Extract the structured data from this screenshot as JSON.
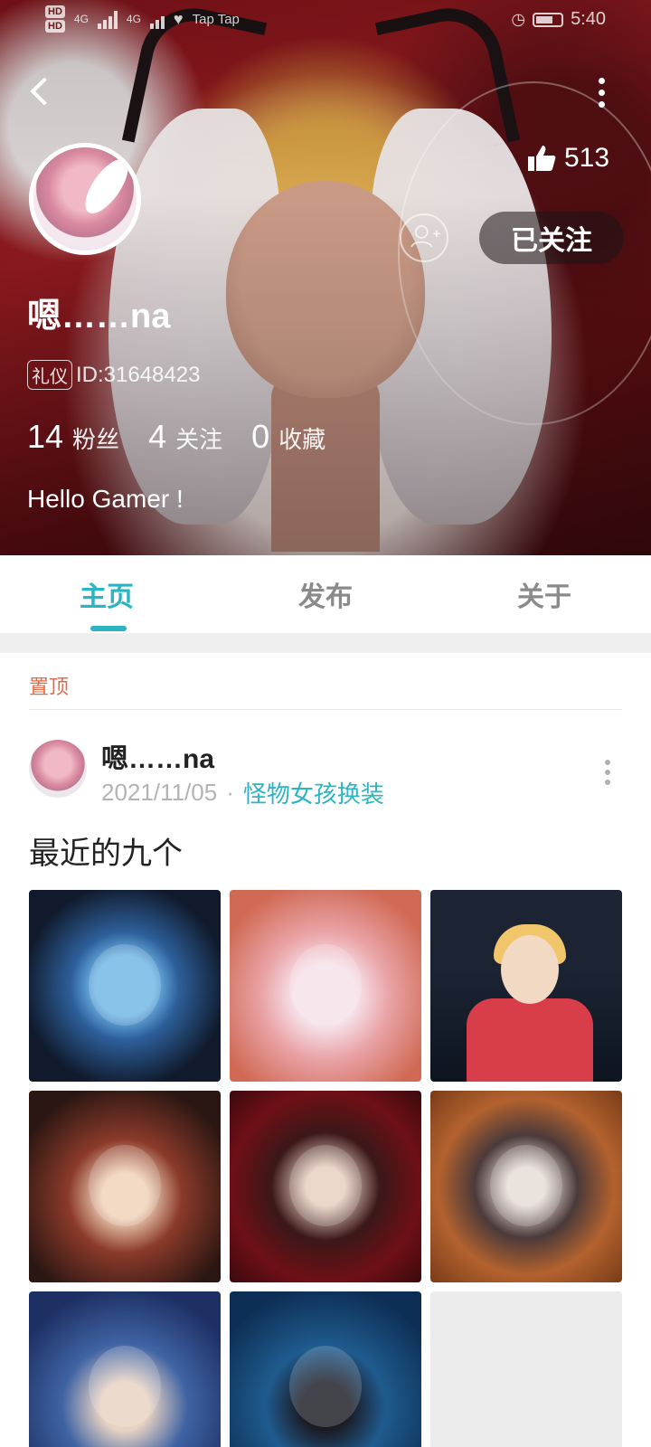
{
  "status_bar": {
    "hd1": "HD",
    "hd2": "HD",
    "net1": "4G",
    "net2": "4G",
    "app_label": "Tap Tap",
    "time": "5:40"
  },
  "profile": {
    "username": "嗯……na",
    "badge": "礼仪",
    "id_text": "ID:31648423",
    "likes": "513",
    "follow_button": "已关注",
    "stats": [
      {
        "num": "14",
        "label": "粉丝"
      },
      {
        "num": "4",
        "label": "关注"
      },
      {
        "num": "0",
        "label": "收藏"
      }
    ],
    "bio": "Hello Gamer !"
  },
  "tabs": [
    {
      "label": "主页",
      "active": true
    },
    {
      "label": "发布",
      "active": false
    },
    {
      "label": "关于",
      "active": false
    }
  ],
  "pinned_label": "置顶",
  "post": {
    "author": "嗯……na",
    "date": "2021/11/05",
    "separator": "·",
    "group": "怪物女孩换装",
    "title": "最近的九个"
  },
  "colors": {
    "accent": "#2bb5c2",
    "pinned": "#e16a48",
    "header_red": "#8f1a1f"
  },
  "icons": {
    "back": "chevron-left-icon",
    "more": "more-vertical-icon",
    "like": "thumbs-up-icon",
    "add_follow": "add-user-icon"
  }
}
